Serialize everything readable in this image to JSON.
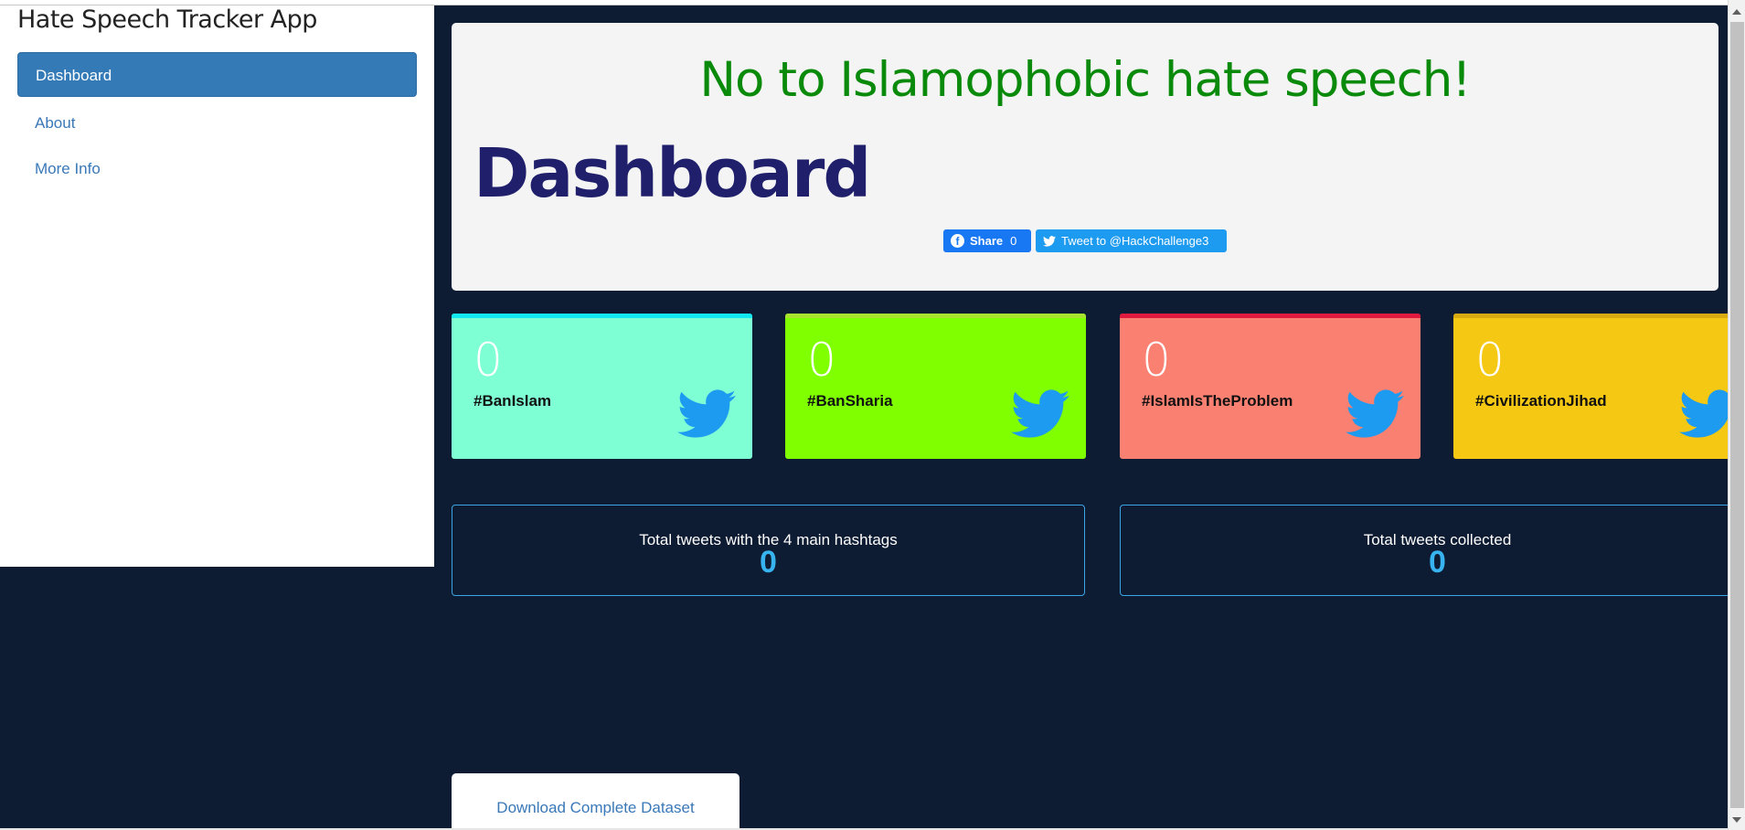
{
  "app": {
    "title": "Hate Speech Tracker App"
  },
  "sidebar": {
    "items": [
      {
        "label": "Dashboard",
        "active": true
      },
      {
        "label": "About",
        "active": false
      },
      {
        "label": "More Info",
        "active": false
      }
    ]
  },
  "hero": {
    "tagline": "No to Islamophobic hate speech!",
    "title": "Dashboard",
    "share_button": {
      "label": "Share",
      "count": "0",
      "icon": "facebook-icon"
    },
    "tweet_button": {
      "label": "Tweet to @HackChallenge3",
      "icon": "twitter-bird-icon"
    }
  },
  "hashtag_cards": [
    {
      "count": "0",
      "hashtag": "#BanIslam",
      "bg": "#7fffd4",
      "stripe": "#12e8f0"
    },
    {
      "count": "0",
      "hashtag": "#BanSharia",
      "bg": "#7fff00",
      "stripe": "#a6e22e"
    },
    {
      "count": "0",
      "hashtag": "#IslamIsTheProblem",
      "bg": "#fa8072",
      "stripe": "#e0193f"
    },
    {
      "count": "0",
      "hashtag": "#CivilizationJihad",
      "bg": "#f5c814",
      "stripe": "#d9ab12"
    }
  ],
  "totals": [
    {
      "label": "Total tweets with the 4 main hashtags",
      "value": "0"
    },
    {
      "label": "Total tweets collected",
      "value": "0"
    }
  ],
  "download": {
    "label": "Download Complete Dataset"
  },
  "colors": {
    "background": "#0d1b33",
    "accent_blue": "#337ab7",
    "twitter_blue": "#1d9bf0",
    "tagline_green": "#0a8a0a",
    "title_navy": "#1f1f6b"
  }
}
